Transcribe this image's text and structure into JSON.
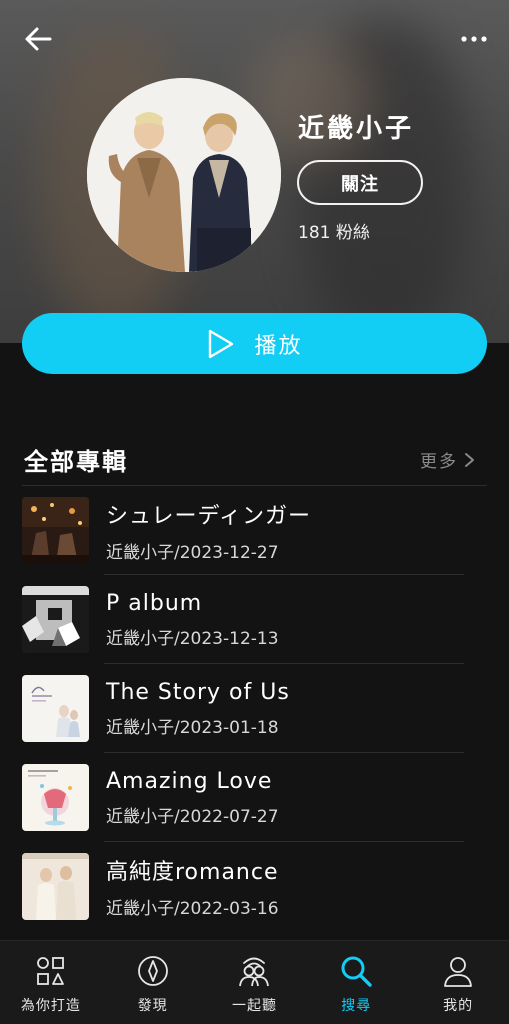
{
  "artist": {
    "name": "近畿小子",
    "follow_label": "關注",
    "fans": "181 粉絲"
  },
  "actions": {
    "play_label": "播放"
  },
  "albums_section": {
    "title": "全部專輯",
    "more_label": "更多"
  },
  "albums": [
    {
      "title": "シュレーディンガー",
      "subtitle": "近畿小子/2023-12-27"
    },
    {
      "title": "P album",
      "subtitle": "近畿小子/2023-12-13"
    },
    {
      "title": "The Story of Us",
      "subtitle": "近畿小子/2023-01-18"
    },
    {
      "title": "Amazing Love",
      "subtitle": "近畿小子/2022-07-27"
    },
    {
      "title": "高純度romance",
      "subtitle": "近畿小子/2022-03-16"
    }
  ],
  "nav": [
    {
      "label": "為你打造",
      "icon": "shapes-icon",
      "active": false
    },
    {
      "label": "發現",
      "icon": "compass-icon",
      "active": false
    },
    {
      "label": "一起聽",
      "icon": "listen-together-icon",
      "active": false
    },
    {
      "label": "搜尋",
      "icon": "search-icon",
      "active": true
    },
    {
      "label": "我的",
      "icon": "profile-icon",
      "active": false
    }
  ],
  "colors": {
    "accent": "#12cdf4",
    "background": "#131313",
    "header_bg": "#4a4a4a"
  }
}
